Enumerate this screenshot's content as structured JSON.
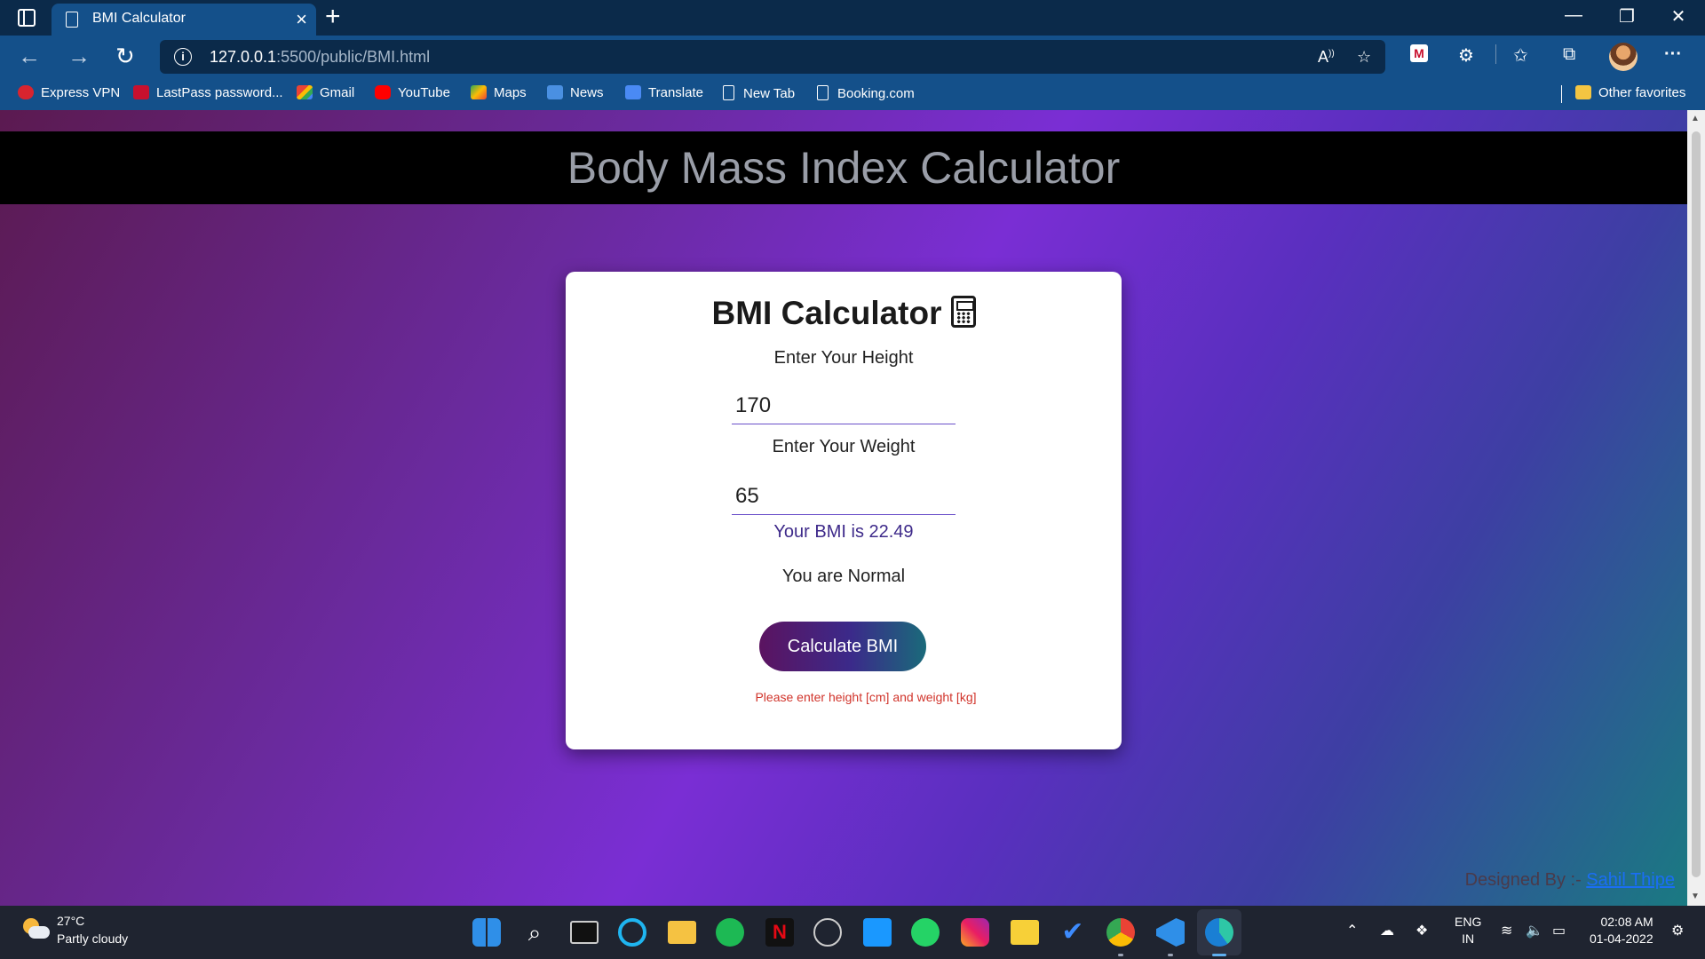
{
  "browser": {
    "tab_title": "BMI Calculator",
    "url_host": "127.0.0.1",
    "url_path": ":5500/public/BMI.html",
    "bookmarks": [
      "Express VPN",
      "LastPass password...",
      "Gmail",
      "YouTube",
      "Maps",
      "News",
      "Translate",
      "New Tab",
      "Booking.com"
    ],
    "other_favorites": "Other favorites"
  },
  "page": {
    "header": "Body Mass Index Calculator",
    "card_title": "BMI Calculator",
    "height_label": "Enter Your Height",
    "height_value": "170",
    "weight_label": "Enter Your Weight",
    "weight_value": "65",
    "result": "Your BMI is 22.49",
    "status": "You are Normal",
    "button": "Calculate BMI",
    "hint": "Please enter height [cm] and weight [kg]",
    "credit_prefix": "Designed By :- ",
    "credit_name": "Sahil Thipe"
  },
  "taskbar": {
    "temperature": "27°C",
    "weather": "Partly cloudy",
    "lang_top": "ENG",
    "lang_bottom": "IN",
    "time": "02:08 AM",
    "date": "01-04-2022"
  },
  "colors": {
    "chrome_dark": "#0b2a4a",
    "chrome_mid": "#14508a",
    "accent_button": "#3b2a8a",
    "error_text": "#d1342b",
    "link": "#1a6ef5"
  }
}
